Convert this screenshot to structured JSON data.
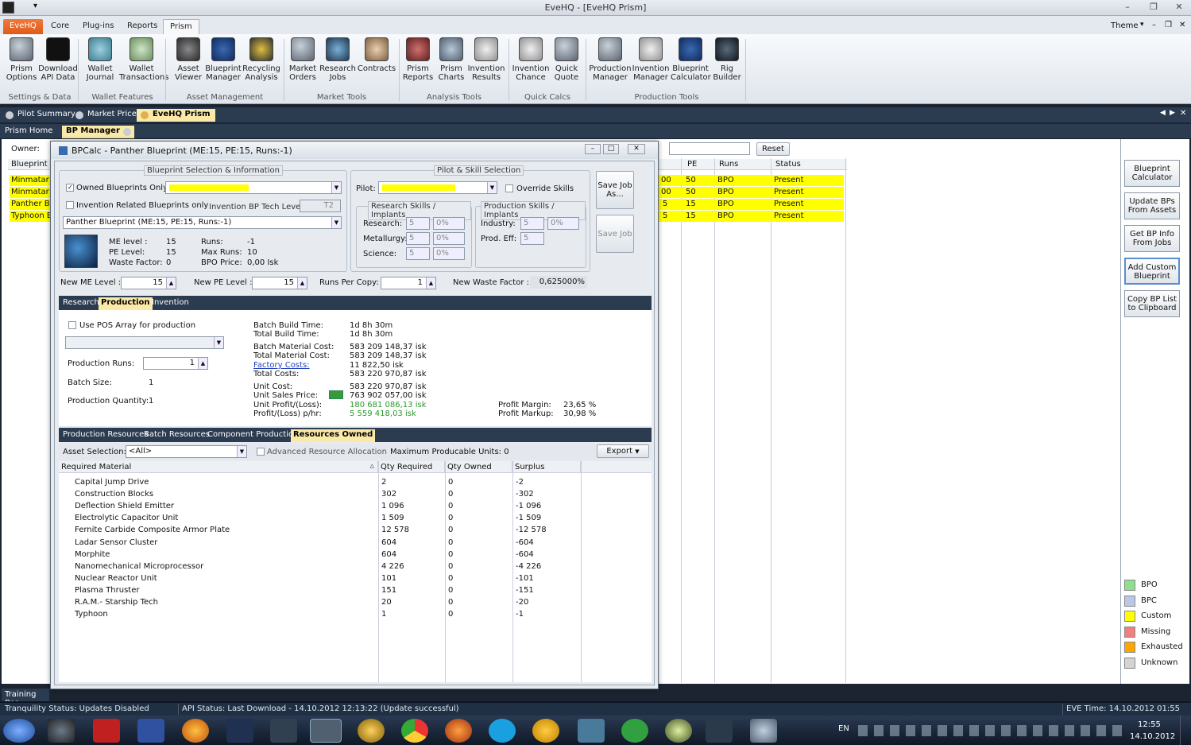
{
  "window": {
    "title": "EveHQ - [EveHQ Prism]",
    "qa": "▾",
    "theme": "Theme"
  },
  "ribbon_tabs": [
    "EveHQ",
    "Core",
    "Plug-ins",
    "Reports",
    "Prism"
  ],
  "ribbon_buttons": [
    {
      "l1": "Prism",
      "l2": "Options"
    },
    {
      "l1": "Download",
      "l2": "API Data"
    },
    {
      "l1": "Wallet",
      "l2": "Journal"
    },
    {
      "l1": "Wallet",
      "l2": "Transactions"
    },
    {
      "l1": "Asset",
      "l2": "Viewer"
    },
    {
      "l1": "Blueprint",
      "l2": "Manager"
    },
    {
      "l1": "Recycling",
      "l2": "Analysis"
    },
    {
      "l1": "Market",
      "l2": "Orders"
    },
    {
      "l1": "Research",
      "l2": "Jobs"
    },
    {
      "l1": "Contracts",
      "l2": ""
    },
    {
      "l1": "Prism",
      "l2": "Reports"
    },
    {
      "l1": "Prism",
      "l2": "Charts"
    },
    {
      "l1": "Invention",
      "l2": "Results"
    },
    {
      "l1": "Invention",
      "l2": "Chance"
    },
    {
      "l1": "Quick",
      "l2": "Quote"
    },
    {
      "l1": "Production",
      "l2": "Manager"
    },
    {
      "l1": "Invention",
      "l2": "Manager"
    },
    {
      "l1": "Blueprint",
      "l2": "Calculator"
    },
    {
      "l1": "Rig",
      "l2": "Builder"
    }
  ],
  "ribbon_groups": [
    "Settings & Data",
    "Wallet Features",
    "Asset Management",
    "Market Tools",
    "Analysis Tools",
    "Quick Calcs",
    "Production Tools"
  ],
  "doc_tabs": [
    "Pilot Summary",
    "Market Prices",
    "EveHQ Prism"
  ],
  "sub_tabs": [
    "Prism Home",
    "BP Manager"
  ],
  "owner_label": "Owner:",
  "reset_label": "Reset",
  "bp_grid": {
    "headers": [
      "Blueprint",
      "PE",
      "Runs",
      "Status"
    ],
    "rows": [
      {
        "name": "Minmatar Bl",
        "me": "00",
        "pe": "50",
        "runs": "BPO",
        "status": "Present"
      },
      {
        "name": "Minmatar Fl",
        "me": "00",
        "pe": "50",
        "runs": "BPO",
        "status": "Present"
      },
      {
        "name": "Panther Blu",
        "me": "5",
        "pe": "15",
        "runs": "BPO",
        "status": "Present"
      },
      {
        "name": "Typhoon Bl",
        "me": "5",
        "pe": "15",
        "runs": "BPO",
        "status": "Present"
      }
    ]
  },
  "side_buttons": [
    {
      "l1": "Blueprint",
      "l2": "Calculator"
    },
    {
      "l1": "Update BPs",
      "l2": "From Assets"
    },
    {
      "l1": "Get BP Info",
      "l2": "From Jobs"
    },
    {
      "l1": "Add Custom",
      "l2": "Blueprint"
    },
    {
      "l1": "Copy BP List",
      "l2": "to Clipboard"
    }
  ],
  "legend": [
    {
      "label": "BPO",
      "color": "#8ee08e"
    },
    {
      "label": "BPC",
      "color": "#b9c8e6"
    },
    {
      "label": "Custom",
      "color": "#ffff00"
    },
    {
      "label": "Missing",
      "color": "#f08080"
    },
    {
      "label": "Exhausted",
      "color": "#ffa500"
    },
    {
      "label": "Unknown",
      "color": "#d3d3d3"
    }
  ],
  "dialog": {
    "title": "BPCalc - Panther Blueprint (ME:15, PE:15, Runs:-1)",
    "bp_section": "Blueprint Selection & Information",
    "pilot_section": "Pilot & Skill Selection",
    "owned_only": "Owned Blueprints Only",
    "invention_only": "Invention Related Blueprints only",
    "invention_tech": "Invention BP Tech Level:",
    "tech_value": "T2",
    "bp_select": "Panther Blueprint (ME:15, PE:15, Runs:-1)",
    "info": {
      "me_l": "ME level :",
      "me_v": "15",
      "pe_l": "PE Level:",
      "pe_v": "15",
      "wf_l": "Waste Factor:",
      "wf_v": "0",
      "runs_l": "Runs:",
      "runs_v": "-1",
      "maxruns_l": "Max Runs:",
      "maxruns_v": "10",
      "bpo_l": "BPO Price:",
      "bpo_v": "0,00 Isk"
    },
    "pilot_label": "Pilot:",
    "override": "Override Skills",
    "research_skills": "Research Skills / Implants",
    "production_skills": "Production Skills / Implants",
    "research": "Research:",
    "metallurgy": "Metallurgy:",
    "science": "Science:",
    "industry": "Industry:",
    "prod_eff": "Prod. Eff:",
    "skill_val": "5",
    "pct_val": "0%",
    "save_job_as_1": "Save Job",
    "save_job_as_2": "As...",
    "save_job": "Save Job",
    "new_me": "New ME Level :",
    "new_me_v": "15",
    "new_pe": "New PE Level :",
    "new_pe_v": "15",
    "runs_per_copy": "Runs Per Copy:",
    "runs_per_copy_v": "1",
    "new_waste": "New Waste Factor :",
    "new_waste_v": "0,625000%",
    "tabs": [
      "Research",
      "Production",
      "Invention"
    ],
    "use_pos": "Use POS Array for production",
    "prod_runs": "Production Runs:",
    "prod_runs_v": "1",
    "batch_size": "Batch Size:",
    "batch_size_v": "1",
    "prod_qty": "Production Quantity:",
    "prod_qty_v": "1",
    "costs": [
      {
        "l": "Batch Build Time:",
        "v": "1d 8h 30m"
      },
      {
        "l": "Total Build Time:",
        "v": "1d 8h 30m"
      },
      {
        "l": "Batch Material Cost:",
        "v": "583 209 148,37 isk"
      },
      {
        "l": "Total Material Cost:",
        "v": "583 209 148,37 isk"
      },
      {
        "l": "Factory Costs:",
        "v": "11 822,50 isk"
      },
      {
        "l": "Total Costs:",
        "v": "583 220 970,87 isk"
      },
      {
        "l": "Unit Cost:",
        "v": "583 220 970,87 isk"
      },
      {
        "l": "Unit Sales Price:",
        "v": "763 902 057,00 isk"
      },
      {
        "l": "Unit Profit/(Loss):",
        "v": "180 681 086,13 isk"
      },
      {
        "l": "Profit/(Loss) p/hr:",
        "v": "5 559 418,03 isk"
      }
    ],
    "profit_margin": "Profit Margin:",
    "profit_margin_v": "23,65 %",
    "profit_markup": "Profit Markup:",
    "profit_markup_v": "30,98 %",
    "res_tabs": [
      "Production Resources",
      "Batch Resources",
      "Component Production",
      "Resources Owned"
    ],
    "asset_sel": "Asset Selection:",
    "asset_val": "<All>",
    "adv_alloc": "Advanced Resource Allocation",
    "max_units": "Maximum Producable Units: 0",
    "export": "Export",
    "mat_headers": [
      "Required Material",
      "Qty Required",
      "Qty Owned",
      "Surplus"
    ],
    "materials": [
      [
        "Capital Jump Drive",
        "2",
        "0",
        "-2"
      ],
      [
        "Construction Blocks",
        "302",
        "0",
        "-302"
      ],
      [
        "Deflection Shield Emitter",
        "1 096",
        "0",
        "-1 096"
      ],
      [
        "Electrolytic Capacitor Unit",
        "1 509",
        "0",
        "-1 509"
      ],
      [
        "Fernite Carbide Composite Armor Plate",
        "12 578",
        "0",
        "-12 578"
      ],
      [
        "Ladar Sensor Cluster",
        "604",
        "0",
        "-604"
      ],
      [
        "Morphite",
        "604",
        "0",
        "-604"
      ],
      [
        "Nanomechanical Microprocessor",
        "4 226",
        "0",
        "-4 226"
      ],
      [
        "Nuclear Reactor Unit",
        "101",
        "0",
        "-101"
      ],
      [
        "Plasma Thruster",
        "151",
        "0",
        "-151"
      ],
      [
        "R.A.M.- Starship Tech",
        "20",
        "0",
        "-20"
      ],
      [
        "Typhoon",
        "1",
        "0",
        "-1"
      ]
    ]
  },
  "training_bar": "Training Bar",
  "status": {
    "tranq": "Tranquility Status: Updates Disabled",
    "api": "API Status: Last Download - 14.10.2012 12:13:22 (Update successful)",
    "evetime": "EVE Time: 14.10.2012 01:55"
  },
  "taskbar": {
    "lang": "EN",
    "time": "12:55",
    "date": "14.10.2012"
  }
}
